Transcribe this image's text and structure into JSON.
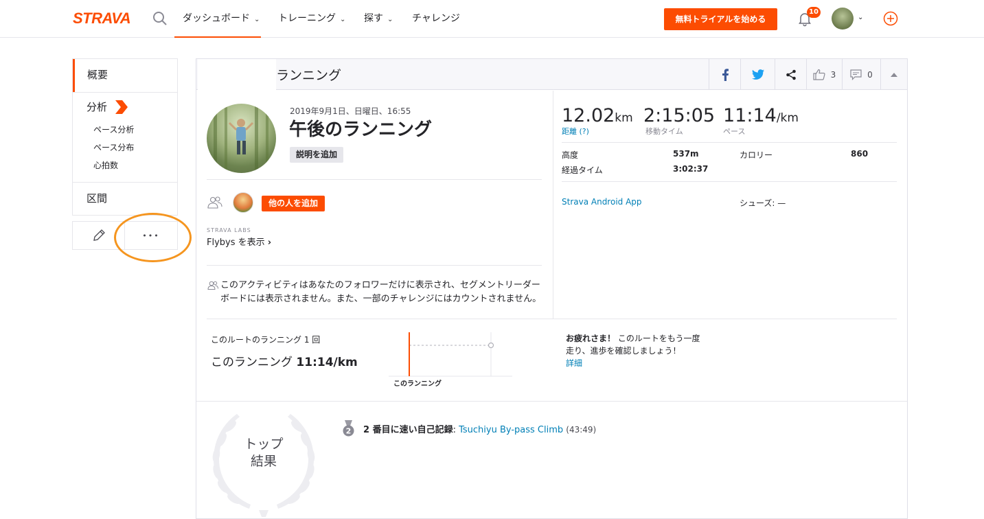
{
  "nav": {
    "logo": "STRAVA",
    "items": [
      {
        "label": "ダッシュボード",
        "has_menu": true
      },
      {
        "label": "トレーニング",
        "has_menu": true
      },
      {
        "label": "探す",
        "has_menu": true
      },
      {
        "label": "チャレンジ",
        "has_menu": false
      }
    ],
    "trial_button": "無料トライアルを始める",
    "notification_count": "10",
    "accent_color": "#fc4c02"
  },
  "sidebar": {
    "overview": "概要",
    "analysis": "分析",
    "analysis_items": [
      "ペース分析",
      "ペース分布",
      "心拍数"
    ],
    "segments": "区間",
    "more_label": "•••"
  },
  "header": {
    "title": "ランニング",
    "kudos_count": "3",
    "comment_count": "0"
  },
  "activity": {
    "date": "2019年9月1日、日曜日、16:55",
    "title": "午後のランニング",
    "add_description": "説明を追加",
    "add_others": "他の人を追加",
    "labs": "STRAVA LABS",
    "flybys": "Flybys を表示",
    "privacy_line1": "このアクティビティはあなたのフォロワーだけに表示され、セグメントリーダー",
    "privacy_line2": "ボードには表示されません。また、一部のチャレンジにはカウントされません。"
  },
  "stats": {
    "distance_value": "12.02",
    "distance_unit": "km",
    "distance_label": "距離 (?)",
    "moving_time_value": "2:15:05",
    "moving_time_label": "移動タイム",
    "pace_value": "11:14",
    "pace_unit": "/km",
    "pace_label": "ペース",
    "elevation_label": "高度",
    "elevation_value": "537m",
    "calories_label": "カロリー",
    "calories_value": "860",
    "elapsed_label": "経過タイム",
    "elapsed_value": "3:02:37",
    "device": "Strava Android App",
    "shoes": "シューズ: —"
  },
  "route": {
    "count_text": "このルートのランニング 1 回",
    "pace_prefix": "このランニング",
    "pace_value": "11:14/km",
    "chart_label": "このランニング",
    "encourage_bold": "お疲れさま！",
    "encourage_line1": " このルートをもう一度",
    "encourage_line2": "走り、進歩を確認しましょう！",
    "details_link": "詳細"
  },
  "results": {
    "laurel_line1": "トップ",
    "laurel_line2": "結果",
    "medal_number": "2",
    "achievement_prefix": "2 番目に速い自己記録",
    "segment_name": "Tsuchiyu By-pass Climb",
    "segment_time": "(43:49)"
  }
}
